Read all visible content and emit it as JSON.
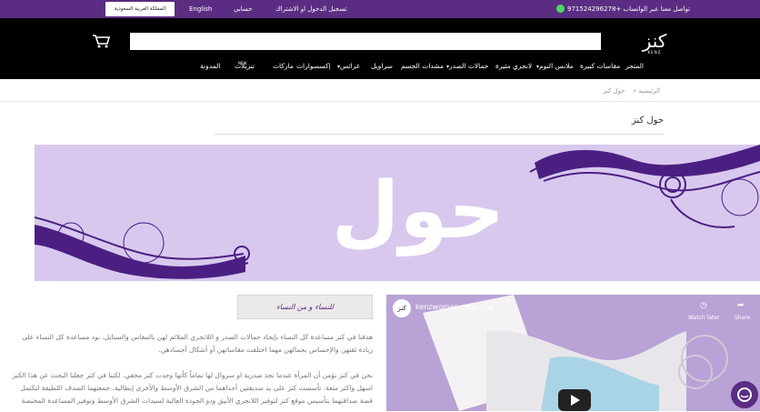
{
  "topbar": {
    "whatsapp": "تواصل معنا عبر الواتساب +971524296278",
    "login": "تسجيل الدخول او الاشتراك",
    "account": "حسابي",
    "language": "English",
    "country": "المملكة العربية السعودية"
  },
  "header": {
    "logo_text": "كنز",
    "logo_sub": "KENZ",
    "search_placeholder": ""
  },
  "nav": {
    "items": [
      {
        "label": "المتجر",
        "has_dropdown": false
      },
      {
        "label": "مقاسات كبيرة",
        "has_dropdown": false
      },
      {
        "label": "ملابس النوم",
        "has_dropdown": true
      },
      {
        "label": "لانجري مثيرة",
        "has_dropdown": false
      },
      {
        "label": "حمالات الصدر",
        "has_dropdown": true
      },
      {
        "label": "مشدات الجسم",
        "has_dropdown": false
      },
      {
        "label": "سراويل",
        "has_dropdown": false
      },
      {
        "label": "عرائس",
        "has_dropdown": true
      },
      {
        "label": "إكسسوارات",
        "has_dropdown": false
      },
      {
        "label": "ماركات",
        "has_dropdown": false
      },
      {
        "label": "تنزيلات",
        "has_dropdown": false
      },
      {
        "label": "المدونة",
        "has_dropdown": false
      }
    ],
    "new_badge": "NEW"
  },
  "breadcrumb": {
    "home": "الرئيسية",
    "sep": "»",
    "current": "حول كنز"
  },
  "page": {
    "title": "حول كنز",
    "banner_text": "حول كنز",
    "quote": "للنساء و من النساء",
    "paragraphs": [
      "هدفنا في كنز مساعدة كل النساء بإيجاد حمالات الصدر و اللانجري الملائم لهن بالمقاس والستايل، نود مساعدة كل النساء على",
      "زيادة ثقتهن والإحساس بجمالهن مهما اختلفت مقاساتهن أو أشكال أجسادهن.",
      "نحن في كنز نؤمن أن المرأة عندما تجد صدرية او سروال لها تماماً كأنها وجدت كنز مخفي. لكننا في كنز جعلنا البحث عن هذا الكنز",
      "اسهل واكثر متعة. تأسست كنز على يد صديقتين أحداهما من الشرق الأوسط والأخرى إيطالية، جمعتهما الصدف اللطيفة لتكتمل",
      "قصة صداقتهما بتأسيس موقع كنز لتوفير اللانجري الأنيق ودو الجودة العالية لسيدات الشرق الأوسط وتوفير المساعدة المختصة"
    ]
  },
  "video": {
    "channel": "kenzwoman.com - كنز",
    "watch_later": "Watch later",
    "share": "Share"
  },
  "colors": {
    "brand_purple": "#5a2d82",
    "banner_bg": "#d8c8ee",
    "lace": "#4b1f82"
  }
}
